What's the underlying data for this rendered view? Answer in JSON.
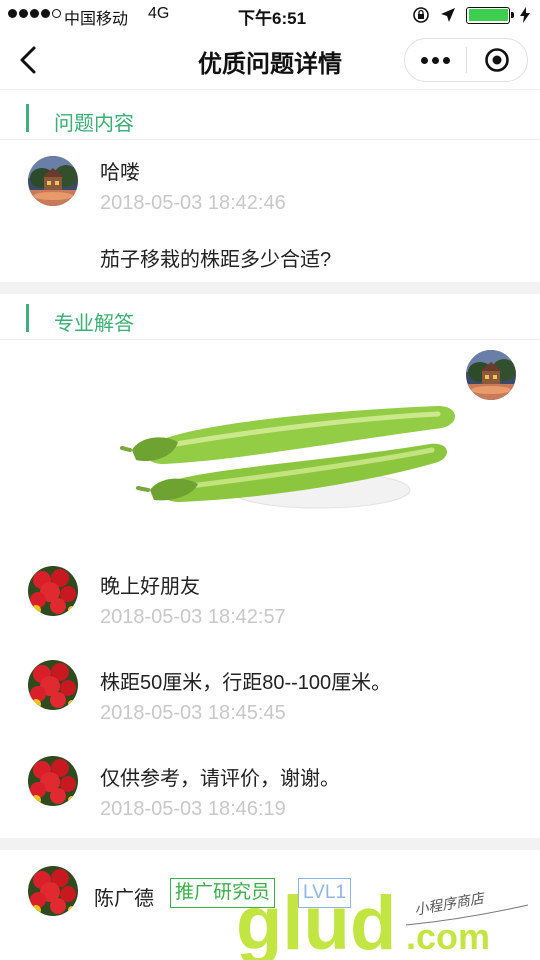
{
  "status_bar": {
    "carrier": "中国移动",
    "network": "4G",
    "time": "下午6:51",
    "battery_color": "#3ccf4e"
  },
  "nav": {
    "title": "优质问题详情",
    "back_icon": "chevron-left-icon",
    "more_icon": "more-dots-icon",
    "close_icon": "target-circle-icon"
  },
  "question_section": {
    "header": "问题内容",
    "author": "哈喽",
    "time": "2018-05-03 18:42:46",
    "content": "茄子移栽的株距多少合适?"
  },
  "answer_section": {
    "header": "专业解答",
    "messages": [
      {
        "text": "晚上好朋友",
        "time": "2018-05-03 18:42:57"
      },
      {
        "text": "株距50厘米，行距80--100厘米。",
        "time": "2018-05-03 18:45:45"
      },
      {
        "text": "仅供参考，请评价，谢谢。",
        "time": "2018-05-03 18:46:19"
      }
    ]
  },
  "expert": {
    "name": "陈广德",
    "role_tag": "推广研究员",
    "level_tag": "LVL1"
  },
  "watermark": {
    "brand": "glud",
    "suffix": ".com",
    "handwriting": "小程序商店"
  },
  "colors": {
    "accent_green": "#3aaf73",
    "time_gray": "#c8c8c8",
    "tag_green": "#3aaf4a",
    "tag_blue": "#8fb6e6"
  }
}
